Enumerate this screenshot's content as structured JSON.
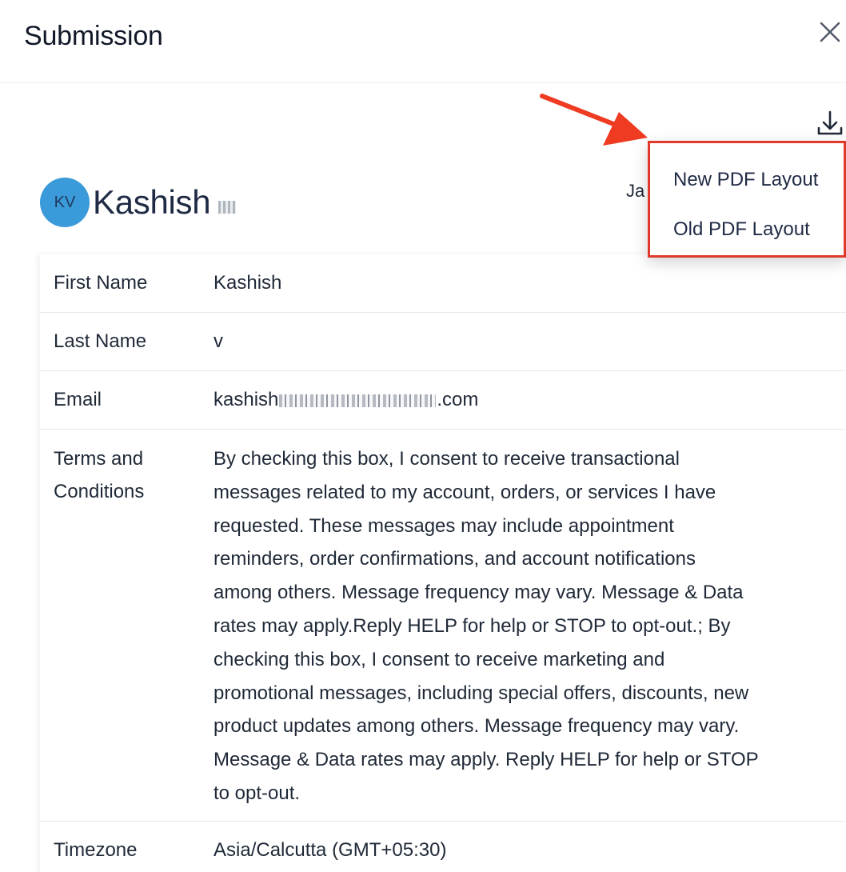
{
  "header": {
    "title": "Submission",
    "close_icon": "close-icon"
  },
  "toolbar": {
    "download_icon": "download-icon"
  },
  "download_menu": {
    "items": [
      {
        "label": "New PDF Layout"
      },
      {
        "label": "Old PDF Layout"
      }
    ]
  },
  "submitter": {
    "initials": "KV",
    "name": "Kashish",
    "date_partial": "Ja"
  },
  "fields": {
    "first_name": {
      "label": "First Name",
      "value": "Kashish"
    },
    "last_name": {
      "label": "Last Name",
      "value": "v"
    },
    "email": {
      "label": "Email",
      "value_prefix": "kashish",
      "value_suffix": ".com"
    },
    "terms": {
      "label_line1": "Terms and",
      "label_line2": "Conditions",
      "lines": [
        "By checking this box, I consent to receive transactional",
        "messages related to my account, orders, or services I have",
        "requested. These messages may include appointment",
        "reminders, order confirmations, and account notifications",
        "among others. Message frequency may vary. Message & Data",
        "rates may apply.Reply HELP for help or STOP to opt-out.; By",
        "checking this box, I consent to receive marketing and",
        "promotional messages, including special offers, discounts, new",
        "product updates among others. Message frequency may vary.",
        "Message & Data rates may apply. Reply HELP for help or STOP",
        "to opt-out."
      ]
    },
    "timezone": {
      "label": "Timezone",
      "value": "Asia/Calcutta (GMT+05:30)"
    }
  },
  "colors": {
    "highlight": "#e03a2a",
    "avatar": "#3b9ad9"
  }
}
